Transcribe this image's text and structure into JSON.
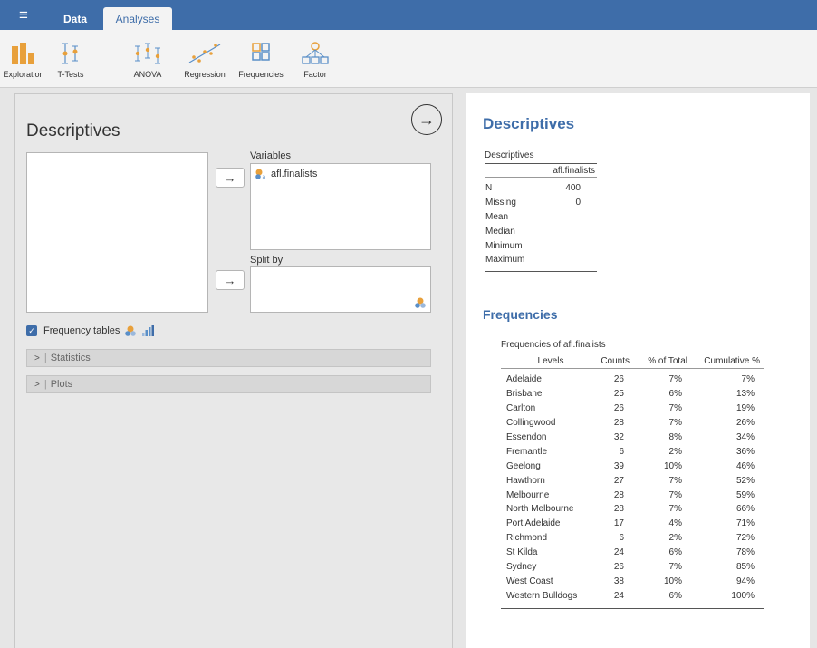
{
  "app": {
    "menu_glyph": "≡",
    "tabs": [
      {
        "label": "Data",
        "active": false
      },
      {
        "label": "Analyses",
        "active": true
      }
    ],
    "accent_color": "#3e6da9"
  },
  "ribbon": {
    "buttons": [
      {
        "label": "Exploration",
        "icon": "exploration-icon"
      },
      {
        "label": "T-Tests",
        "icon": "ttests-icon"
      },
      {
        "label": "ANOVA",
        "icon": "anova-icon"
      },
      {
        "label": "Regression",
        "icon": "regression-icon"
      },
      {
        "label": "Frequencies",
        "icon": "frequencies-icon"
      },
      {
        "label": "Factor",
        "icon": "factor-icon"
      }
    ]
  },
  "options": {
    "title": "Descriptives",
    "move_arrow": "→",
    "go_glyph": "→",
    "variables_label": "Variables",
    "variables": [
      "afl.finalists"
    ],
    "split_by_label": "Split by",
    "frequency_tables_label": "Frequency tables",
    "frequency_tables_checked": true,
    "check_glyph": "✓",
    "sections": [
      {
        "label": "Statistics",
        "expanded": false
      },
      {
        "label": "Plots",
        "expanded": false
      }
    ],
    "chevron": ">",
    "separator": "|"
  },
  "results": {
    "heading": "Descriptives",
    "descriptives_table": {
      "title": "Descriptives",
      "column": "afl.finalists",
      "rows": [
        {
          "stat": "N",
          "value": "400"
        },
        {
          "stat": "Missing",
          "value": "0"
        },
        {
          "stat": "Mean",
          "value": ""
        },
        {
          "stat": "Median",
          "value": ""
        },
        {
          "stat": "Minimum",
          "value": ""
        },
        {
          "stat": "Maximum",
          "value": ""
        }
      ]
    },
    "frequencies_heading": "Frequencies",
    "frequencies_table": {
      "title": "Frequencies of afl.finalists",
      "headers": [
        "Levels",
        "Counts",
        "% of Total",
        "Cumulative %"
      ],
      "rows": [
        [
          "Adelaide",
          "26",
          "7%",
          "7%"
        ],
        [
          "Brisbane",
          "25",
          "6%",
          "13%"
        ],
        [
          "Carlton",
          "26",
          "7%",
          "19%"
        ],
        [
          "Collingwood",
          "28",
          "7%",
          "26%"
        ],
        [
          "Essendon",
          "32",
          "8%",
          "34%"
        ],
        [
          "Fremantle",
          "6",
          "2%",
          "36%"
        ],
        [
          "Geelong",
          "39",
          "10%",
          "46%"
        ],
        [
          "Hawthorn",
          "27",
          "7%",
          "52%"
        ],
        [
          "Melbourne",
          "28",
          "7%",
          "59%"
        ],
        [
          "North Melbourne",
          "28",
          "7%",
          "66%"
        ],
        [
          "Port Adelaide",
          "17",
          "4%",
          "71%"
        ],
        [
          "Richmond",
          "6",
          "2%",
          "72%"
        ],
        [
          "St Kilda",
          "24",
          "6%",
          "78%"
        ],
        [
          "Sydney",
          "26",
          "7%",
          "85%"
        ],
        [
          "West Coast",
          "38",
          "10%",
          "94%"
        ],
        [
          "Western Bulldogs",
          "24",
          "6%",
          "100%"
        ]
      ]
    }
  }
}
